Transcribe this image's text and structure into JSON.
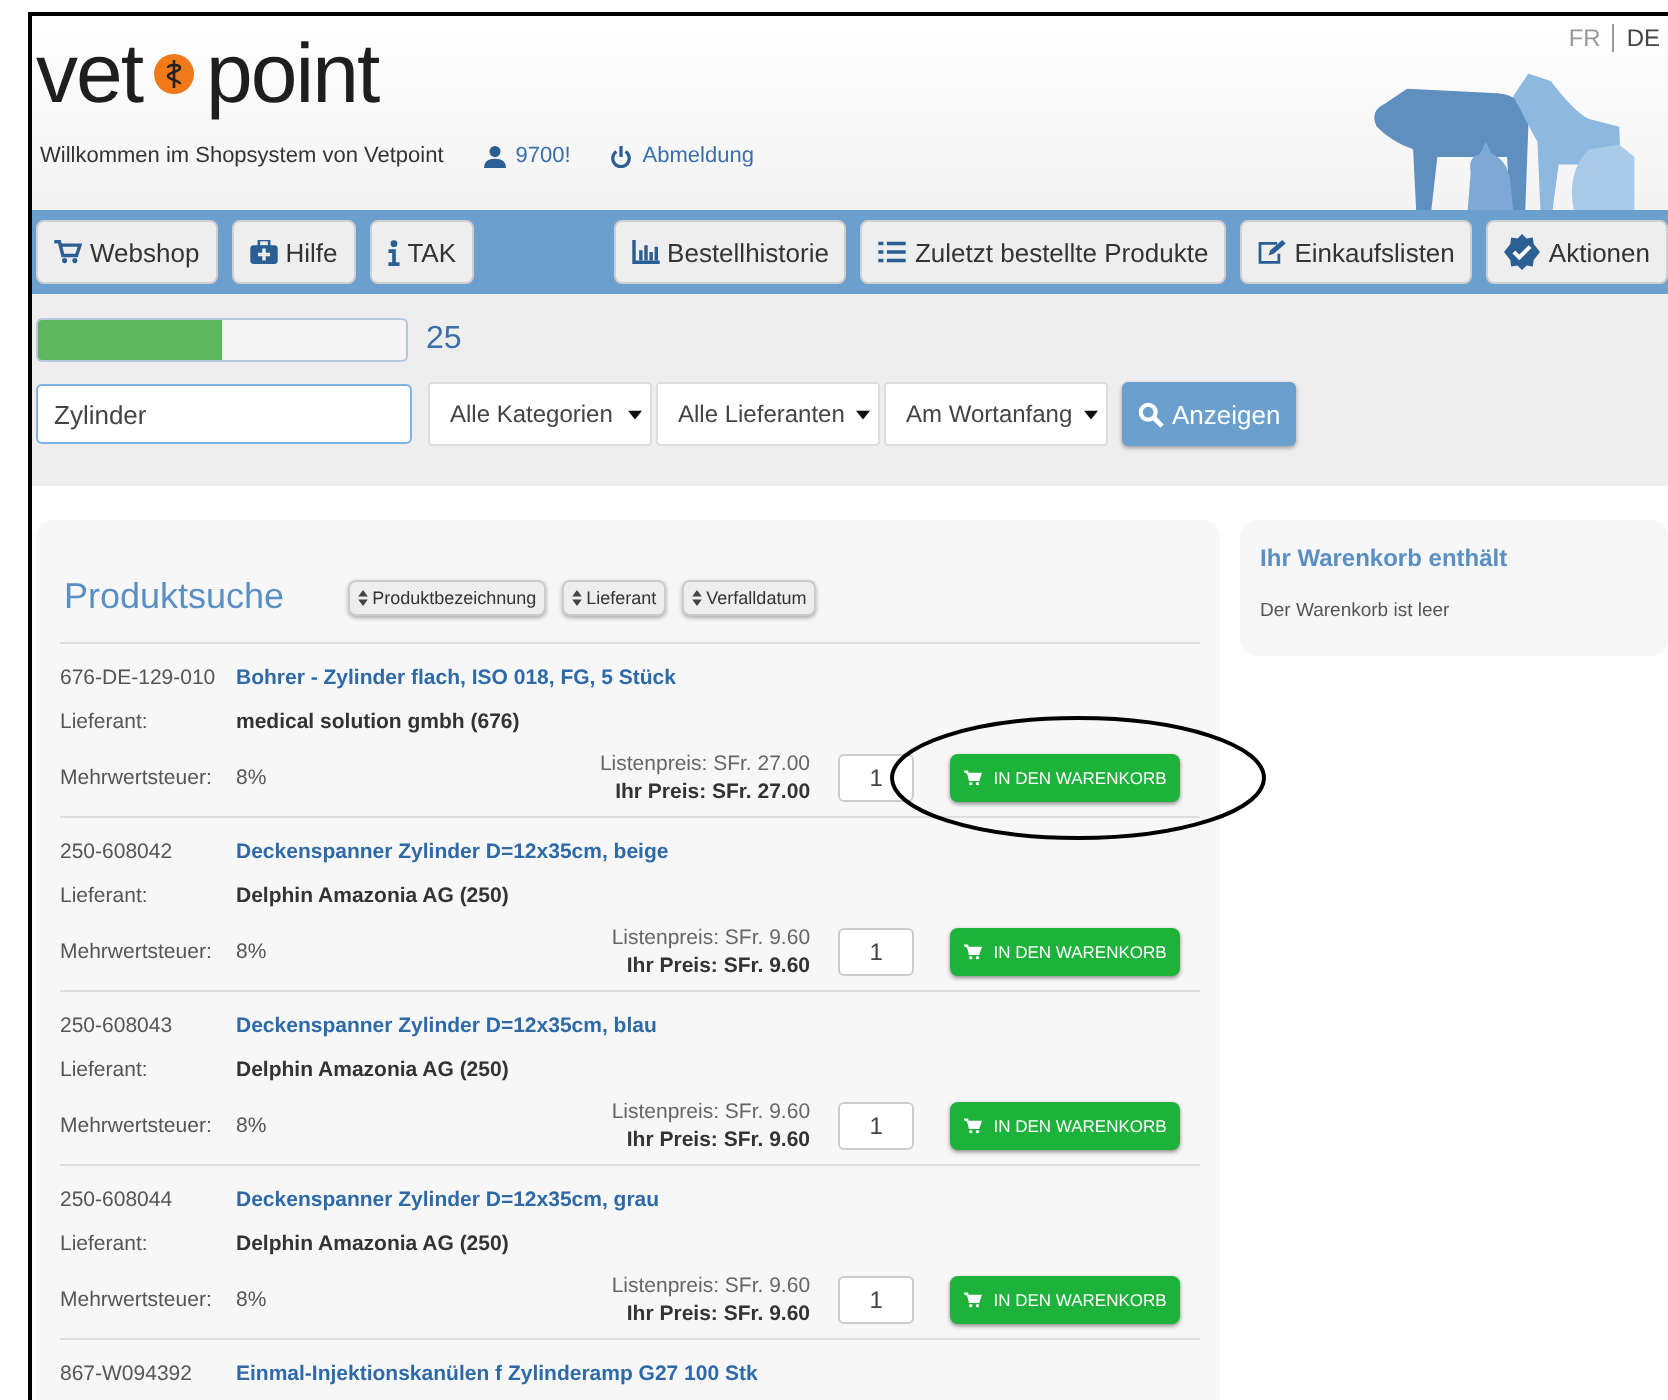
{
  "header": {
    "logo_left": "vet",
    "logo_right": "point",
    "languages": [
      {
        "label": "FR",
        "selected": false
      },
      {
        "label": "DE",
        "selected": true
      }
    ],
    "welcome": "Willkommen im Shopsystem von Vetpoint",
    "user": "9700!",
    "logout": "Abmeldung"
  },
  "nav": {
    "left": [
      {
        "label": "Webshop",
        "kind": "cart"
      },
      {
        "label": "Hilfe",
        "kind": "medkit"
      },
      {
        "label": "TAK",
        "kind": "info"
      }
    ],
    "right": [
      {
        "label": "Bestellhistorie",
        "kind": "chart"
      },
      {
        "label": "Zuletzt bestellte Produkte",
        "kind": "list"
      },
      {
        "label": "Einkaufslisten",
        "kind": "edit"
      },
      {
        "label": "Aktionen",
        "kind": "badge"
      }
    ]
  },
  "search": {
    "progress": {
      "level": 0.5,
      "count": "25"
    },
    "value": "Zylinder",
    "selects": [
      "Alle Kategorien",
      "Alle Lieferanten",
      "Am Wortanfang"
    ],
    "button": "Anzeigen"
  },
  "results": {
    "title": "Produktsuche",
    "sort_buttons": [
      "Produktbezeichnung",
      "Lieferant",
      "Verfalldatum"
    ],
    "products": [
      {
        "code": "676-DE-129-010",
        "name": "Bohrer - Zylinder flach, ISO 018, FG, 5 Stück",
        "supplier_label": "Lieferant:",
        "supplier": "medical solution gmbh (676)",
        "vat_label": "Mehrwertsteuer:",
        "vat": "8%",
        "list_price": "Listenpreis: SFr. 27.00",
        "your_price": "Ihr Preis: SFr. 27.00",
        "quantity": "1",
        "button": "IN DEN WARENKORB",
        "highlighted": true
      },
      {
        "code": "250-608042",
        "name": "Deckenspanner Zylinder D=12x35cm, beige",
        "supplier_label": "Lieferant:",
        "supplier": "Delphin Amazonia AG (250)",
        "vat_label": "Mehrwertsteuer:",
        "vat": "8%",
        "list_price": "Listenpreis: SFr. 9.60",
        "your_price": "Ihr Preis: SFr. 9.60",
        "quantity": "1",
        "button": "IN DEN WARENKORB",
        "highlighted": false
      },
      {
        "code": "250-608043",
        "name": "Deckenspanner Zylinder D=12x35cm, blau",
        "supplier_label": "Lieferant:",
        "supplier": "Delphin Amazonia AG (250)",
        "vat_label": "Mehrwertsteuer:",
        "vat": "8%",
        "list_price": "Listenpreis: SFr. 9.60",
        "your_price": "Ihr Preis: SFr. 9.60",
        "quantity": "1",
        "button": "IN DEN WARENKORB",
        "highlighted": false
      },
      {
        "code": "250-608044",
        "name": "Deckenspanner Zylinder D=12x35cm, grau",
        "supplier_label": "Lieferant:",
        "supplier": "Delphin Amazonia AG (250)",
        "vat_label": "Mehrwertsteuer:",
        "vat": "8%",
        "list_price": "Listenpreis: SFr. 9.60",
        "your_price": "Ihr Preis: SFr. 9.60",
        "quantity": "1",
        "button": "IN DEN WARENKORB",
        "highlighted": false
      },
      {
        "code": "867-W094392",
        "name": "Einmal-Injektionskanülen f Zylinderamp G27 100 Stk"
      }
    ]
  },
  "cart": {
    "title": "Ihr Warenkorb enthält",
    "text": "Der Warenkorb ist leer"
  }
}
